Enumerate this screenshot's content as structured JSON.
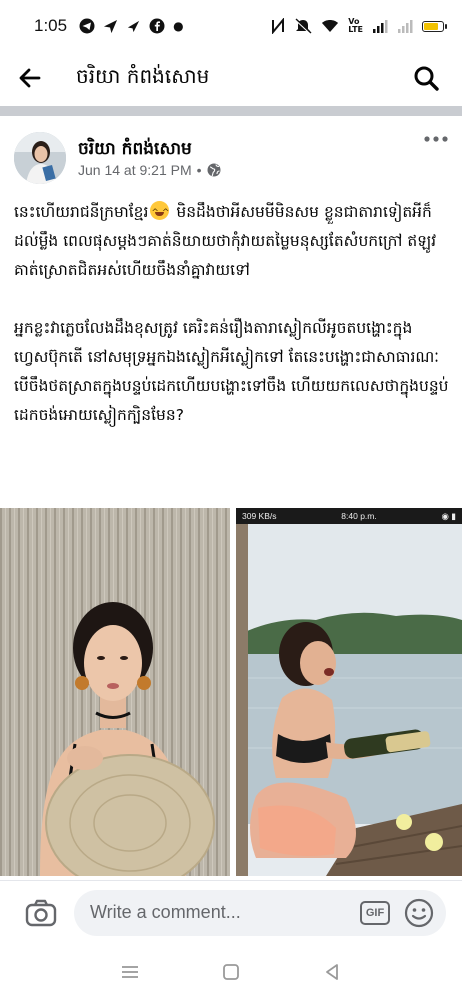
{
  "status_bar": {
    "time": "1:05",
    "battery_level": 0.85
  },
  "header": {
    "title": "ចរិយា កំពង់សោម"
  },
  "post": {
    "author": "ចរិយា កំពង់សោម",
    "timestamp": "Jun 14 at 9:21 PM",
    "meta_separator": "•",
    "paragraph_1_part_a": "នេះហើយរាជនីក្រមាខ្មែរ",
    "paragraph_1_part_b": " មិនដឹងថាអីសមមីមិនសម ខ្លួនជាតារាទៀតអីក៏ដល់ម្លឹង ពេលផុសម្ដងៗគាត់និយាយថាកុំវាយតម្លៃមនុស្សតែសំបកក្រៅ ឥឡូវគាត់ស្រោតជិតអស់ហើយចឹងនាំគ្នាវាយទៅ",
    "paragraph_2": "អ្នកខ្លះវាភ្លេចលែងដឹងខុសត្រូវ គេរិះគន់រឿងតារាស្លៀកលីអូចតបង្ហោះក្នុងហ្វេសប៊ុកតើ នៅសមុទ្រអ្នកឯងស្លៀកអីស្លៀកទៅ តែនេះបង្ហោះជាសាធារណៈ បើចឹងថតស្រាតក្នុងបន្ទប់ដេកហើយបង្ហោះទៅចឹង ហើយយកលេសថាក្នុងបន្ទប់ដេកចង់អោយស្លៀកក្បិនមែន?"
  },
  "photo_right_status": {
    "speed": "309 KB/s",
    "time": "8:40 p.m."
  },
  "comment_bar": {
    "placeholder": "Write a comment...",
    "gif_label": "GIF"
  },
  "icons": {
    "back": "arrow-left-icon",
    "search": "search-icon",
    "more": "more-horizontal-icon",
    "globe": "globe-icon",
    "camera": "camera-icon",
    "gif": "gif-icon",
    "emoji": "smile-icon"
  },
  "colors": {
    "divider": "#c9ccd1",
    "meta_text": "#65676b",
    "input_bg": "#f0f2f5"
  }
}
